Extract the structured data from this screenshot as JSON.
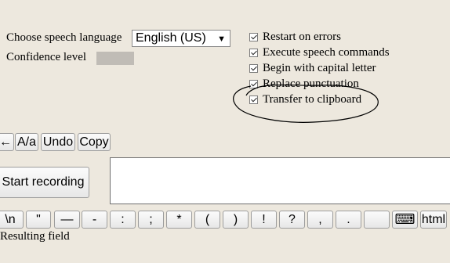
{
  "settings": {
    "language_label": "Choose speech language",
    "language_selected": "English (US)",
    "confidence_label": "Confidence level"
  },
  "options": [
    {
      "label": "Restart on errors",
      "checked": true
    },
    {
      "label": "Execute speech commands",
      "checked": true
    },
    {
      "label": "Begin with capital letter",
      "checked": true
    },
    {
      "label": "Replace punctuation",
      "checked": true
    },
    {
      "label": "Transfer to clipboard",
      "checked": true
    }
  ],
  "edit_buttons": {
    "back": "←",
    "case": "A/a",
    "undo": "Undo",
    "copy": "Copy"
  },
  "start_button": "Start recording",
  "result_field_label": "Resulting field",
  "keys": [
    "\\n",
    "\"",
    "—",
    "-",
    ":",
    ";",
    "*",
    "(",
    ")",
    "!",
    "?",
    ",",
    ".",
    "",
    "⌨",
    "html"
  ],
  "annotation_color": "#000000"
}
